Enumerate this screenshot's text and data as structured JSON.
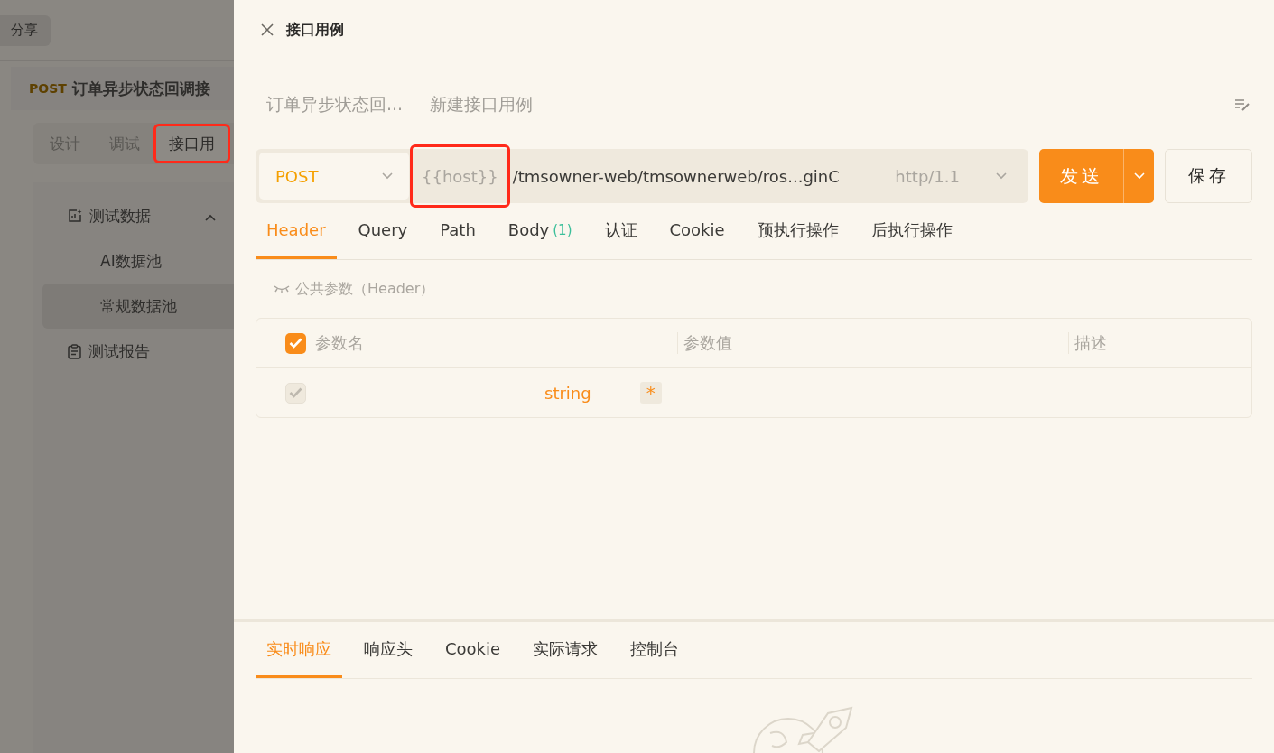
{
  "background": {
    "share_button": "分享",
    "endpoint": {
      "method": "POST",
      "title": "订单异步状态回调接"
    },
    "tabs": [
      {
        "label": "设计",
        "selected": false,
        "highlighted": false
      },
      {
        "label": "调试",
        "selected": false,
        "highlighted": false
      },
      {
        "label": "接口用",
        "selected": true,
        "highlighted": true
      }
    ],
    "tree": [
      {
        "label": "测试数据",
        "kind": "data",
        "expanded": true,
        "children": [
          {
            "label": "AI数据池",
            "selected": false
          },
          {
            "label": "常规数据池",
            "selected": true
          }
        ]
      },
      {
        "label": "测试报告",
        "kind": "report"
      }
    ]
  },
  "drawer": {
    "title": "接口用例",
    "breadcrumb": [
      "订单异步状态回...",
      "新建接口用例"
    ],
    "request": {
      "method": "POST",
      "host": "{{host}}",
      "host_highlighted": true,
      "path": "/tmsowner-web/tmsownerweb/ros...ginC",
      "protocol": "http/1.1",
      "send": "发送",
      "save": "保存"
    },
    "tabs": [
      {
        "label": "Header",
        "selected": true
      },
      {
        "label": "Query",
        "selected": false
      },
      {
        "label": "Path",
        "selected": false
      },
      {
        "label": "Body",
        "count": "(1)",
        "selected": false
      },
      {
        "label": "认证",
        "selected": false
      },
      {
        "label": "Cookie",
        "selected": false
      },
      {
        "label": "预执行操作",
        "selected": false
      },
      {
        "label": "后执行操作",
        "selected": false
      }
    ],
    "common_params": "公共参数（Header）",
    "table": {
      "columns": [
        "参数名",
        "参数值",
        "描述"
      ],
      "all_checked": true,
      "rows": [
        {
          "checked": true,
          "disabled": true,
          "type": "string",
          "required": "*"
        }
      ]
    },
    "response_tabs": [
      {
        "label": "实时响应",
        "selected": true
      },
      {
        "label": "响应头",
        "selected": false
      },
      {
        "label": "Cookie",
        "selected": false
      },
      {
        "label": "实际请求",
        "selected": false
      },
      {
        "label": "控制台",
        "selected": false
      }
    ]
  }
}
